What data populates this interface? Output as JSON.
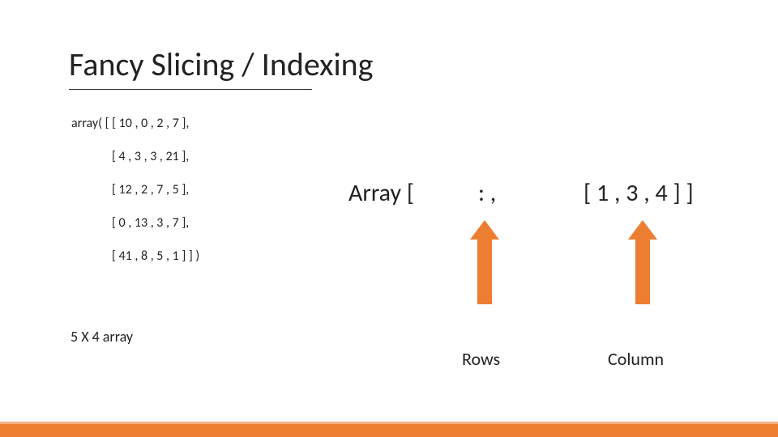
{
  "title": "Fancy Slicing / Indexing",
  "array_rows": [
    "array( [ [ 10 , 0 , 2 , 7 ],",
    "[ 4 , 3 , 3 , 21 ],",
    "[ 12 , 2 , 7 , 5 ],",
    "[ 0 , 13 , 3 , 7 ],",
    "[ 41 , 8 , 5 , 1 ] ] )"
  ],
  "expr": {
    "array_open": "Array [",
    "rows_part": ": ,",
    "cols_part": "[ 1 , 3 , 4 ] ]"
  },
  "labels": {
    "rows": "Rows",
    "cols": "Column"
  },
  "dim_note": "5 X 4 array",
  "chart_data": {
    "type": "table",
    "title": "Fancy Slicing / Indexing",
    "shape": "5 X 4 array",
    "values": [
      [
        10,
        0,
        2,
        7
      ],
      [
        4,
        3,
        3,
        21
      ],
      [
        12,
        2,
        7,
        5
      ],
      [
        0,
        13,
        3,
        7
      ],
      [
        41,
        8,
        5,
        1
      ]
    ],
    "slice_expression": "Array[ : , [1, 3, 4] ]",
    "slice_rows": ":",
    "slice_cols": [
      1,
      3,
      4
    ],
    "annotations": {
      "rows_arrow": "Rows",
      "cols_arrow": "Column"
    }
  }
}
